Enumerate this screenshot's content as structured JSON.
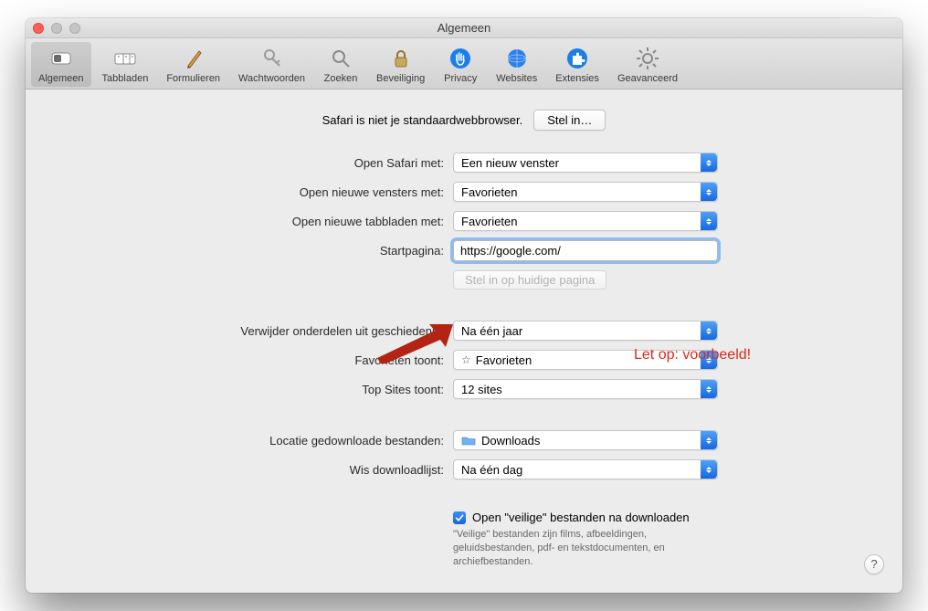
{
  "window": {
    "title": "Algemeen"
  },
  "toolbar": {
    "items": [
      {
        "label": "Algemeen",
        "name": "tab-general",
        "active": true
      },
      {
        "label": "Tabbladen",
        "name": "tab-tabs",
        "active": false
      },
      {
        "label": "Formulieren",
        "name": "tab-autofill",
        "active": false
      },
      {
        "label": "Wachtwoorden",
        "name": "tab-passwords",
        "active": false
      },
      {
        "label": "Zoeken",
        "name": "tab-search",
        "active": false
      },
      {
        "label": "Beveiliging",
        "name": "tab-security",
        "active": false
      },
      {
        "label": "Privacy",
        "name": "tab-privacy",
        "active": false
      },
      {
        "label": "Websites",
        "name": "tab-websites",
        "active": false
      },
      {
        "label": "Extensies",
        "name": "tab-extensions",
        "active": false
      },
      {
        "label": "Geavanceerd",
        "name": "tab-advanced",
        "active": false
      }
    ]
  },
  "default_browser": {
    "message": "Safari is niet je standaardwebbrowser.",
    "button": "Stel in…"
  },
  "fields": {
    "open_safari_with_label": "Open Safari met:",
    "open_safari_with_value": "Een nieuw venster",
    "new_windows_label": "Open nieuwe vensters met:",
    "new_windows_value": "Favorieten",
    "new_tabs_label": "Open nieuwe tabbladen met:",
    "new_tabs_value": "Favorieten",
    "homepage_label": "Startpagina:",
    "homepage_value": "https://google.com/",
    "set_current_page": "Stel in op huidige pagina",
    "remove_history_label": "Verwijder onderdelen uit geschiedenis:",
    "remove_history_value": "Na één jaar",
    "favorites_shows_label": "Favorieten toont:",
    "favorites_shows_value": "Favorieten",
    "topsites_label": "Top Sites toont:",
    "topsites_value": "12 sites",
    "download_location_label": "Locatie gedownloade bestanden:",
    "download_location_value": "Downloads",
    "clear_downloads_label": "Wis downloadlijst:",
    "clear_downloads_value": "Na één dag",
    "safe_open_label": "Open \"veilige\" bestanden na downloaden",
    "safe_open_hint": "\"Veilige\" bestanden zijn films, afbeeldingen, geluidsbestanden, pdf- en tekstdocumenten, en archiefbestanden."
  },
  "annotation": {
    "text": "Let op: voorbeeld!"
  },
  "help": {
    "label": "?"
  }
}
